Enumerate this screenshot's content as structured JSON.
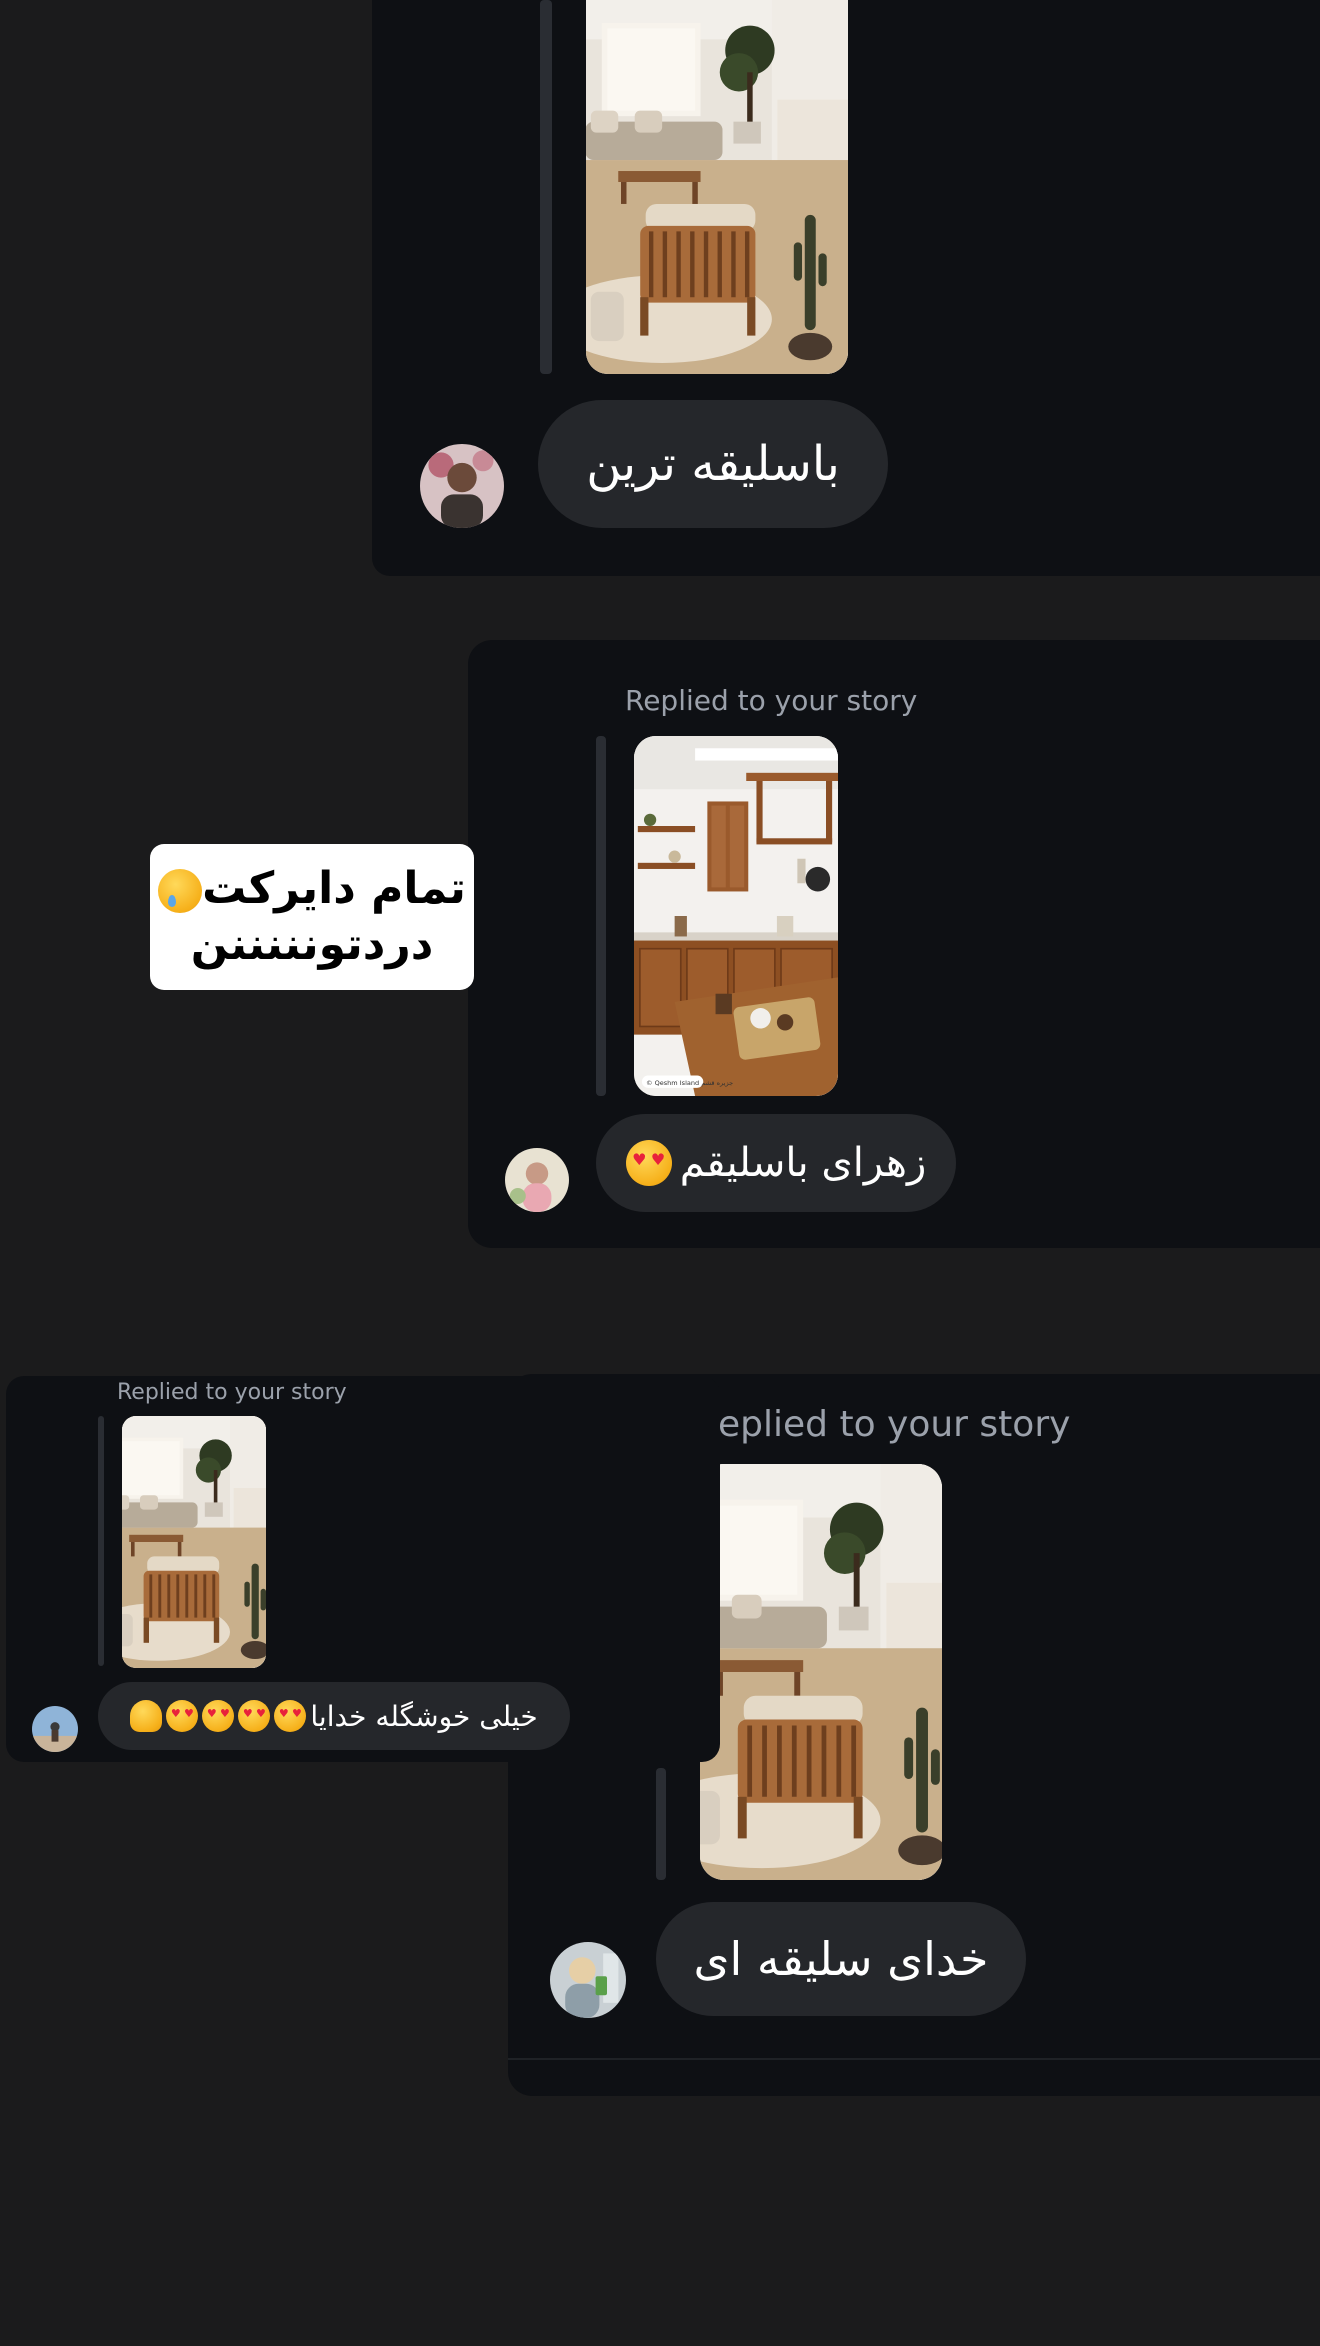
{
  "thread1": {
    "reply_text": "باسلیقه ترین"
  },
  "thread2": {
    "label": "Replied to your story",
    "reply_text": "زهرای باسلیقم",
    "reply_emoji": "heart-eyes-emoji",
    "story_watermark": "© Qeshm Island  جزیره قشم"
  },
  "overlay_sticker": {
    "line1": "تمام دایرکت",
    "line1_emoji": "crying-face-emoji",
    "line2": "دردتونننننن"
  },
  "thread3_small": {
    "label": "Replied to your story",
    "reply_text": "خیلی خوشگله خدایا",
    "reply_emojis": [
      "heart-eyes-emoji",
      "heart-eyes-emoji",
      "heart-eyes-emoji",
      "heart-eyes-emoji",
      "melting-face-emoji"
    ]
  },
  "thread4": {
    "label": "eplied to your story",
    "reply_text": "خدای سلیقه ای"
  },
  "colors": {
    "page_bg": "#1b1b1c",
    "card_bg": "#0e1014",
    "bubble_bg": "#25272b",
    "label_gray": "#9ba1ab"
  }
}
